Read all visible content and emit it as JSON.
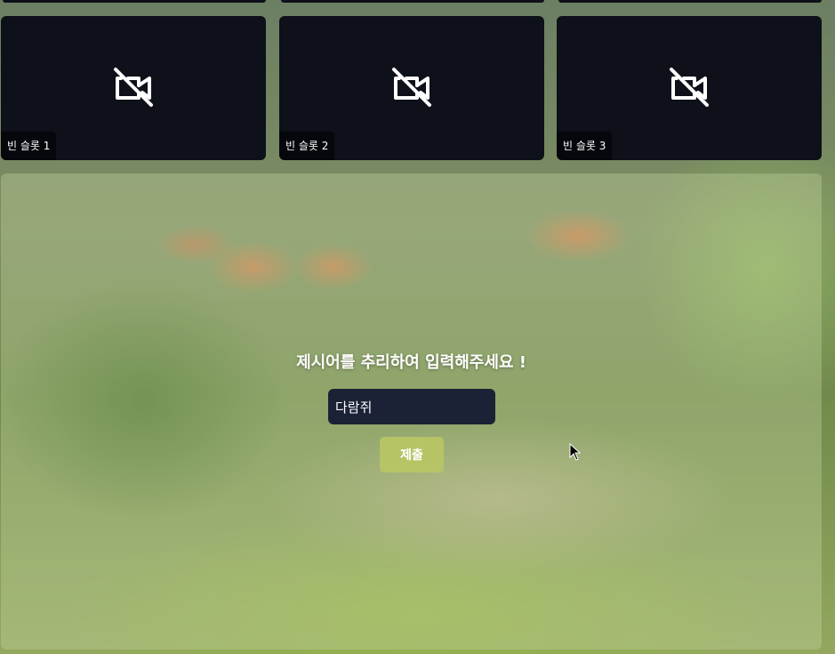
{
  "slots": [
    {
      "label": "빈 슬롯 1",
      "icon": "video-off-icon"
    },
    {
      "label": "빈 슬롯 2",
      "icon": "video-off-icon"
    },
    {
      "label": "빈 슬롯 3",
      "icon": "video-off-icon"
    }
  ],
  "prompt": {
    "title": "제시어를 추리하여 입력해주세요 !",
    "input_value": "다람쥐",
    "submit_label": "제출"
  },
  "colors": {
    "slot_background": "#0e1119",
    "input_background": "#1c2236",
    "submit_background": "#b6c465"
  }
}
